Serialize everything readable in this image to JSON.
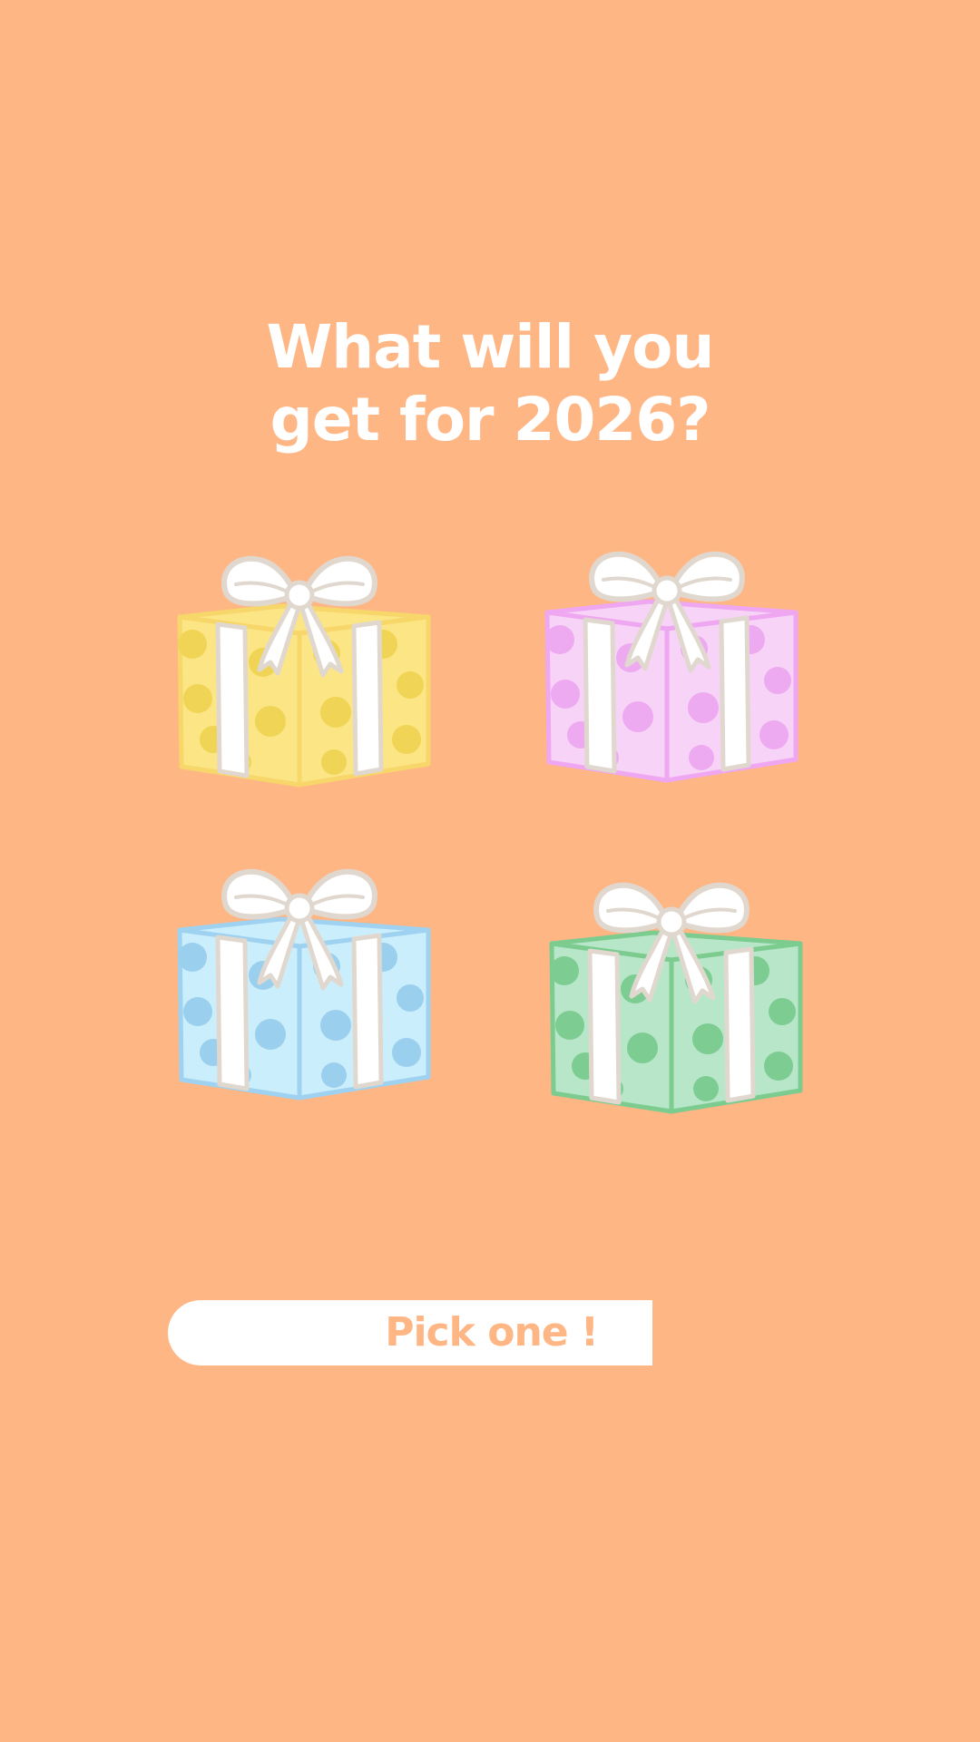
{
  "screen": {
    "background": "#ffb685"
  },
  "header": {
    "title_line1": "What will you",
    "title_line2": "get for 2026?"
  },
  "gifts": [
    {
      "name": "yellow",
      "box": "#fce585",
      "dots": "#f0d455",
      "outline": "#f7d66a"
    },
    {
      "name": "pink",
      "box": "#f7d3f7",
      "dots": "#eeaaf0",
      "outline": "#eea7f0"
    },
    {
      "name": "blue",
      "box": "#cbeefc",
      "dots": "#9bcfee",
      "outline": "#9fd2f0"
    },
    {
      "name": "green",
      "box": "#b8e6c8",
      "dots": "#7dcc92",
      "outline": "#7ccc90"
    }
  ],
  "ribbon": {
    "fill": "#ffffff",
    "outline": "#e0d8cf"
  },
  "cta": {
    "label": "Pick one !",
    "text_color": "#ffb685"
  }
}
